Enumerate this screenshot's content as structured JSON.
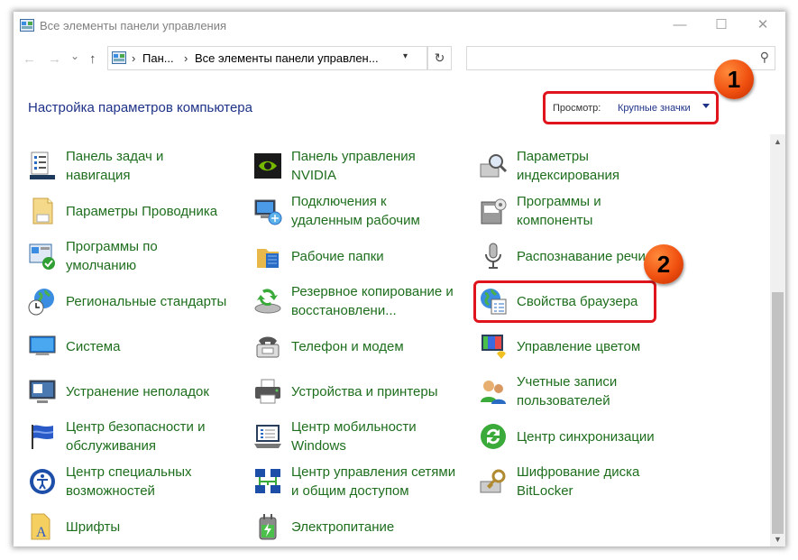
{
  "window": {
    "title": "Все элементы панели управления",
    "controls": [
      "—",
      "☐",
      "✕"
    ]
  },
  "nav": {
    "back": "←",
    "forward": "→",
    "dropdown": "⌄",
    "up": "↑",
    "refresh": "↻"
  },
  "address": {
    "crumbs": [
      "Пан...",
      "Все элементы панели управлен..."
    ],
    "separator": "›"
  },
  "search": {
    "placeholder": "",
    "icon": "search-icon"
  },
  "heading": "Настройка параметров компьютера",
  "view": {
    "label": "Просмотр:",
    "value": "Крупные значки"
  },
  "annotations": {
    "badge1": "1",
    "badge2": "2"
  },
  "items": [
    {
      "label": "Панель задач и\nнавигация",
      "icon": "taskbar-icon"
    },
    {
      "label": "Панель управления\nNVIDIA",
      "icon": "nvidia-icon"
    },
    {
      "label": "Параметры\nиндексирования",
      "icon": "indexing-icon"
    },
    {
      "label": "Параметры Проводника",
      "icon": "folder-options-icon"
    },
    {
      "label": "Подключения к\nудаленным рабочим",
      "icon": "remote-desktop-icon"
    },
    {
      "label": "Программы и\nкомпоненты",
      "icon": "programs-icon"
    },
    {
      "label": "Программы по\nумолчанию",
      "icon": "default-programs-icon"
    },
    {
      "label": "Рабочие папки",
      "icon": "work-folders-icon"
    },
    {
      "label": "Распознавание речи",
      "icon": "microphone-icon"
    },
    {
      "label": "Региональные стандарты",
      "icon": "region-icon"
    },
    {
      "label": "Резервное копирование и\nвосстановлени...",
      "icon": "backup-icon"
    },
    {
      "label": "Свойства браузера",
      "icon": "internet-options-icon"
    },
    {
      "label": "Система",
      "icon": "system-icon"
    },
    {
      "label": "Телефон и модем",
      "icon": "phone-modem-icon"
    },
    {
      "label": "Управление цветом",
      "icon": "color-management-icon"
    },
    {
      "label": "Устранение неполадок",
      "icon": "troubleshooting-icon"
    },
    {
      "label": "Устройства и принтеры",
      "icon": "printer-icon"
    },
    {
      "label": "Учетные записи\nпользователей",
      "icon": "user-accounts-icon"
    },
    {
      "label": "Центр безопасности и\nобслуживания",
      "icon": "security-flag-icon"
    },
    {
      "label": "Центр мобильности\nWindows",
      "icon": "mobility-icon"
    },
    {
      "label": "Центр синхронизации",
      "icon": "sync-icon"
    },
    {
      "label": "Центр специальных\nвозможностей",
      "icon": "accessibility-icon"
    },
    {
      "label": "Центр управления сетями\nи общим доступом",
      "icon": "network-icon"
    },
    {
      "label": "Шифрование диска\nBitLocker",
      "icon": "bitlocker-icon"
    },
    {
      "label": "Шрифты",
      "icon": "fonts-icon"
    },
    {
      "label": "Электропитание",
      "icon": "power-icon"
    }
  ]
}
